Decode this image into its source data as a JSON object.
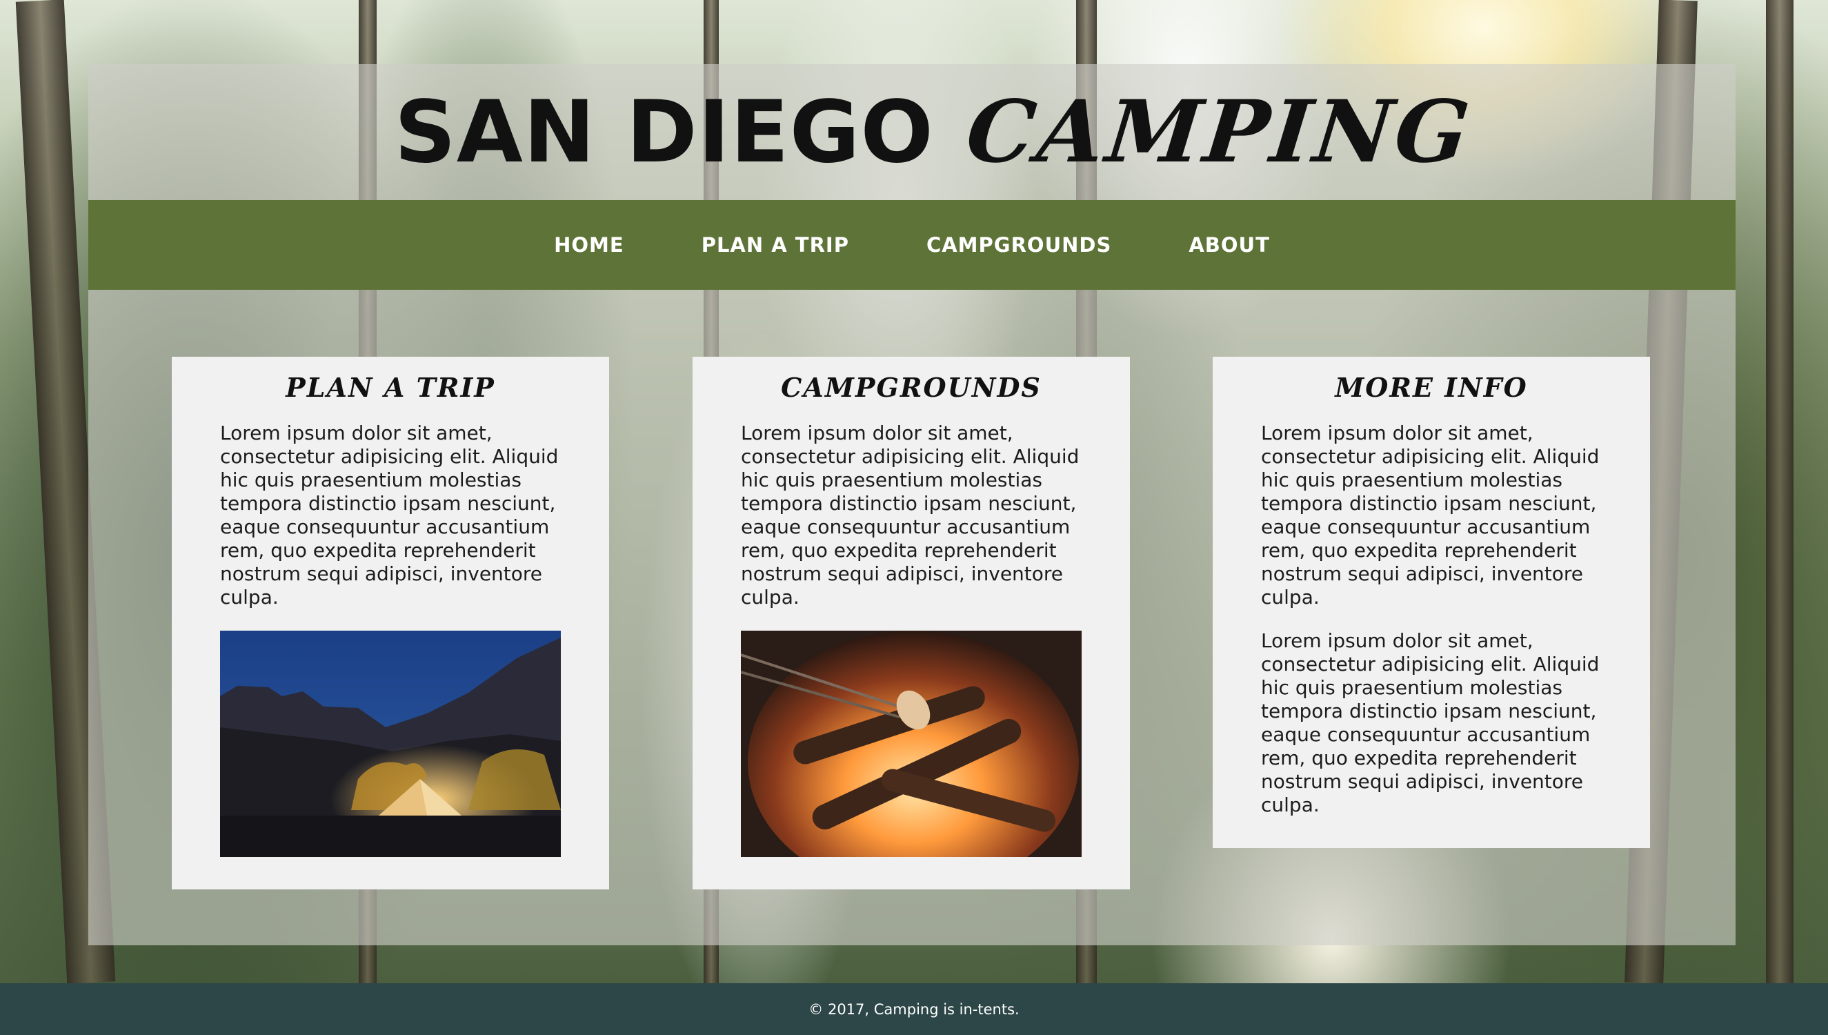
{
  "site": {
    "title_part1": "SAN DIEGO",
    "title_part2": "CAMPING"
  },
  "nav": {
    "items": [
      "HOME",
      "PLAN A TRIP",
      "CAMPGROUNDS",
      "ABOUT"
    ]
  },
  "cards": [
    {
      "heading": "PLAN A TRIP",
      "paragraphs": [
        "Lorem ipsum dolor sit amet, consectetur adipisicing elit. Aliquid hic quis praesentium molestias tempora distinctio ipsam nesciunt, eaque consequuntur accusantium rem, quo expedita reprehenderit nostrum sequi adipisci, inventore culpa."
      ],
      "image": "tent-at-night-photo"
    },
    {
      "heading": "CAMPGROUNDS",
      "paragraphs": [
        "Lorem ipsum dolor sit amet, consectetur adipisicing elit. Aliquid hic quis praesentium molestias tempora distinctio ipsam nesciunt, eaque consequuntur accusantium rem, quo expedita reprehenderit nostrum sequi adipisci, inventore culpa."
      ],
      "image": "campfire-marshmallows-photo"
    },
    {
      "heading": "MORE INFO",
      "paragraphs": [
        "Lorem ipsum dolor sit amet, consectetur adipisicing elit. Aliquid hic quis praesentium molestias tempora distinctio ipsam nesciunt, eaque consequuntur accusantium rem, quo expedita reprehenderit nostrum sequi adipisci, inventore culpa.",
        "Lorem ipsum dolor sit amet, consectetur adipisicing elit. Aliquid hic quis praesentium molestias tempora distinctio ipsam nesciunt, eaque consequuntur accusantium rem, quo expedita reprehenderit nostrum sequi adipisci, inventore culpa."
      ]
    }
  ],
  "footer": {
    "text": "© 2017, Camping is in-tents."
  },
  "colors": {
    "nav_bg": "#5e7337",
    "footer_bg": "#2d4647",
    "card_bg": "#f1f1f1",
    "panel_bg": "#cecec8"
  }
}
